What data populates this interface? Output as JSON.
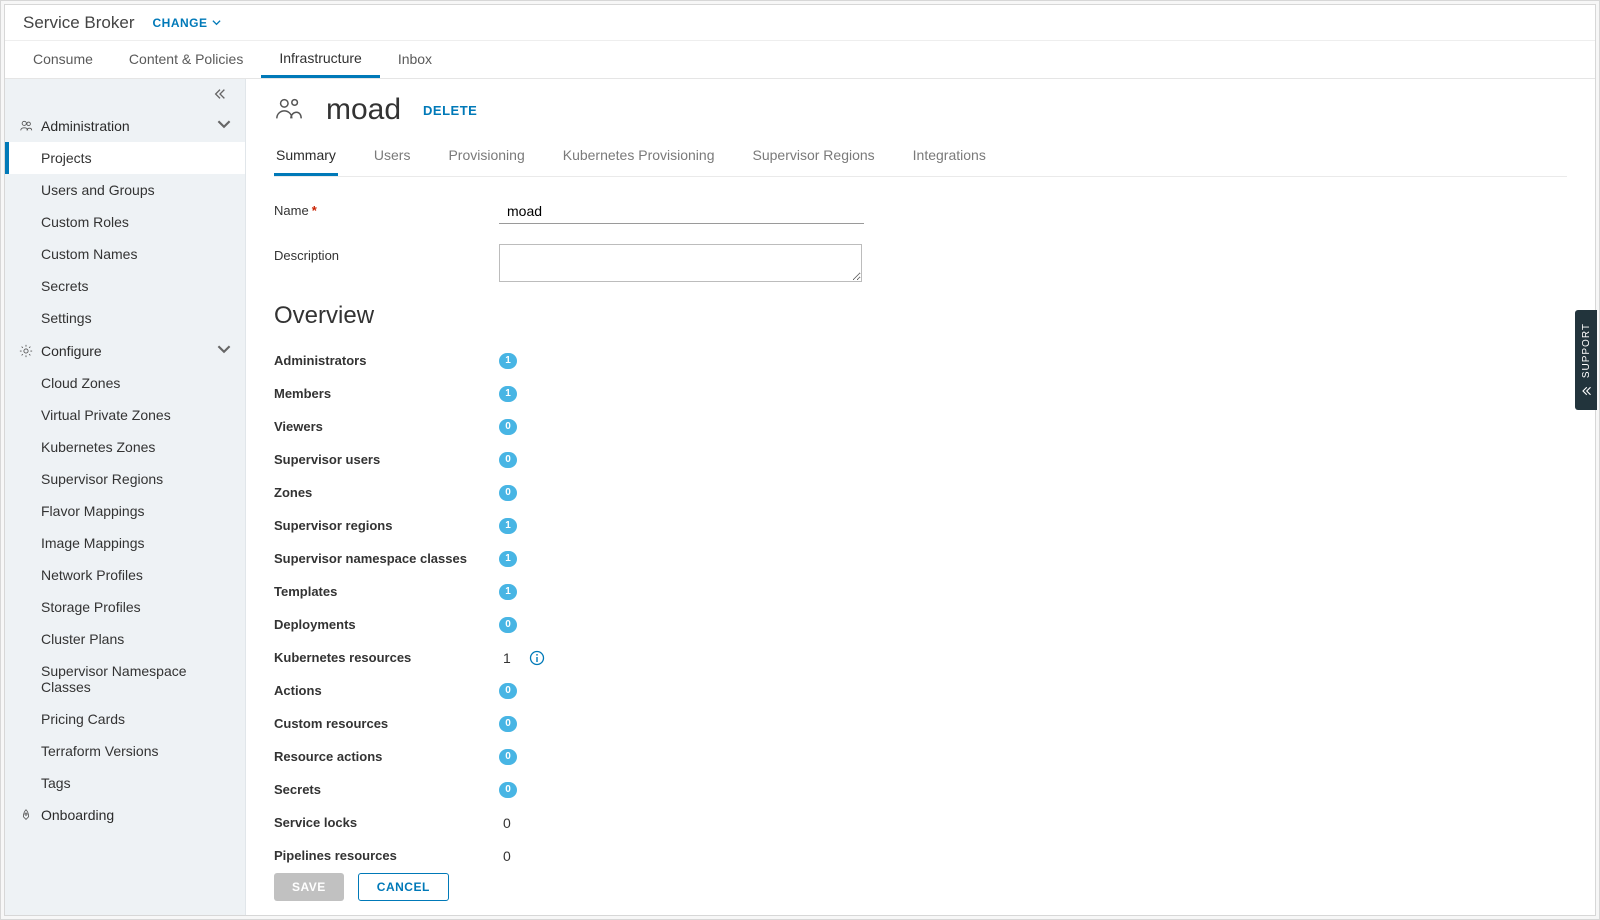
{
  "app": {
    "title": "Service Broker",
    "change_label": "CHANGE"
  },
  "toptabs": {
    "items": [
      {
        "label": "Consume"
      },
      {
        "label": "Content & Policies"
      },
      {
        "label": "Infrastructure",
        "active": true
      },
      {
        "label": "Inbox"
      }
    ]
  },
  "sidebar": {
    "sections": [
      {
        "header": "Administration",
        "items": [
          {
            "label": "Projects",
            "active": true
          },
          {
            "label": "Users and Groups"
          },
          {
            "label": "Custom Roles"
          },
          {
            "label": "Custom Names"
          },
          {
            "label": "Secrets"
          },
          {
            "label": "Settings"
          }
        ]
      },
      {
        "header": "Configure",
        "items": [
          {
            "label": "Cloud Zones"
          },
          {
            "label": "Virtual Private Zones"
          },
          {
            "label": "Kubernetes Zones"
          },
          {
            "label": "Supervisor Regions"
          },
          {
            "label": "Flavor Mappings"
          },
          {
            "label": "Image Mappings"
          },
          {
            "label": "Network Profiles"
          },
          {
            "label": "Storage Profiles"
          },
          {
            "label": "Cluster Plans"
          },
          {
            "label": "Supervisor Namespace Classes"
          },
          {
            "label": "Pricing Cards"
          },
          {
            "label": "Terraform Versions"
          },
          {
            "label": "Tags"
          }
        ]
      },
      {
        "header": "Onboarding",
        "items": []
      }
    ]
  },
  "page": {
    "title": "moad",
    "delete_label": "DELETE",
    "tabs": [
      {
        "label": "Summary",
        "active": true
      },
      {
        "label": "Users"
      },
      {
        "label": "Provisioning"
      },
      {
        "label": "Kubernetes Provisioning"
      },
      {
        "label": "Supervisor Regions"
      },
      {
        "label": "Integrations"
      }
    ],
    "form": {
      "name_label": "Name",
      "name_value": "moad",
      "desc_label": "Description",
      "desc_value": ""
    },
    "overview_title": "Overview",
    "overview": [
      {
        "label": "Administrators",
        "value": "1",
        "badge": true
      },
      {
        "label": "Members",
        "value": "1",
        "badge": true
      },
      {
        "label": "Viewers",
        "value": "0",
        "badge": true
      },
      {
        "label": "Supervisor users",
        "value": "0",
        "badge": true
      },
      {
        "label": "Zones",
        "value": "0",
        "badge": true
      },
      {
        "label": "Supervisor regions",
        "value": "1",
        "badge": true
      },
      {
        "label": "Supervisor namespace classes",
        "value": "1",
        "badge": true
      },
      {
        "label": "Templates",
        "value": "1",
        "badge": true
      },
      {
        "label": "Deployments",
        "value": "0",
        "badge": true
      },
      {
        "label": "Kubernetes resources",
        "value": "1",
        "badge": false,
        "info": true
      },
      {
        "label": "Actions",
        "value": "0",
        "badge": true
      },
      {
        "label": "Custom resources",
        "value": "0",
        "badge": true
      },
      {
        "label": "Resource actions",
        "value": "0",
        "badge": true
      },
      {
        "label": "Secrets",
        "value": "0",
        "badge": true
      },
      {
        "label": "Service locks",
        "value": "0",
        "badge": false
      },
      {
        "label": "Pipelines resources",
        "value": "0",
        "badge": false
      }
    ]
  },
  "footer": {
    "save": "SAVE",
    "cancel": "CANCEL"
  },
  "support": {
    "label": "SUPPORT"
  }
}
